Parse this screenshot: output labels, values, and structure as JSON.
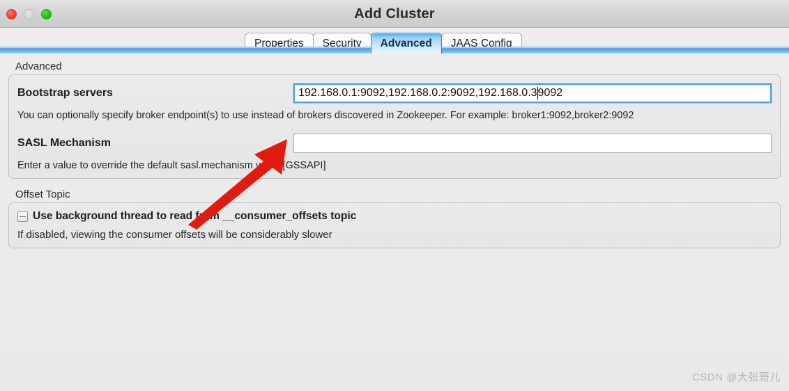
{
  "window": {
    "title": "Add Cluster",
    "controls": {
      "close": "close-button",
      "minimize": "minimize-button",
      "zoom": "zoom-button"
    }
  },
  "tabs": [
    {
      "label": "Properties",
      "active": false
    },
    {
      "label": "Security",
      "active": false
    },
    {
      "label": "Advanced",
      "active": true
    },
    {
      "label": "JAAS Config",
      "active": false
    }
  ],
  "advanced_group": {
    "title": "Advanced",
    "bootstrap": {
      "label": "Bootstrap servers",
      "value_before_caret": "192.168.0.1:9092,192.168.0.2:9092,192.168.0.3",
      "value_after_caret": "9092",
      "full_value": "192.168.0.1:9092,192.168.0.2:9092,192.168.0.3:9092",
      "placeholder": "",
      "help": "You can optionally specify broker endpoint(s) to use instead of brokers discovered in Zookeeper. For example: broker1:9092,broker2:9092"
    },
    "sasl": {
      "label": "SASL Mechanism",
      "value": "",
      "placeholder": "",
      "help": "Enter a value to override the default sasl.mechanism value [GSSAPI]"
    }
  },
  "offset_topic_group": {
    "title": "Offset Topic",
    "checkbox": {
      "label": "Use background thread to read from __consumer_offsets topic",
      "state": "indeterminate"
    },
    "note": "If disabled, viewing the consumer offsets will be considerably slower"
  },
  "annotation": {
    "type": "red-arrow",
    "color": "#e01b10",
    "points_to": "bootstrap-servers-input"
  },
  "watermark": {
    "text": "CSDN @大张哥儿"
  }
}
